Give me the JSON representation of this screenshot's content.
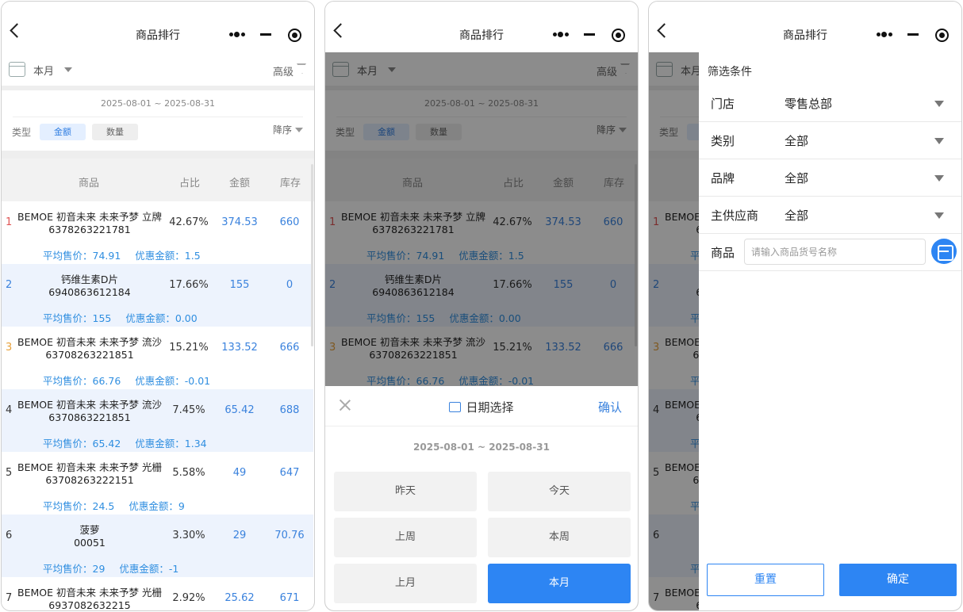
{
  "nav": {
    "title": "商品排行"
  },
  "filter": {
    "period": "本月",
    "advanced": "高级"
  },
  "range": "2025-08-01 ~ 2025-08-31",
  "type": {
    "label": "类型",
    "options": [
      "金额",
      "数量"
    ],
    "selected": "金额",
    "sort": "降序"
  },
  "table": {
    "headers": {
      "product": "商品",
      "ratio": "占比",
      "amount": "金额",
      "stock": "库存"
    },
    "rows": [
      {
        "rank": "1",
        "name": "BEMOE 初音未来 未来予梦 立牌",
        "code": "6378263221781",
        "ratio": "42.67%",
        "amount": "374.53",
        "stock": "660",
        "avg": "平均售价：74.91",
        "discount": "优惠金额：1.5",
        "rank_color": "#e05555"
      },
      {
        "rank": "2",
        "name": "钙维生素D片",
        "code": "6940863612184",
        "ratio": "17.66%",
        "amount": "155",
        "stock": "0",
        "avg": "平均售价：155",
        "discount": "优惠金额：0.00",
        "rank_color": "#3a82dd"
      },
      {
        "rank": "3",
        "name": "BEMOE 初音未来 未来予梦 流沙",
        "code": "63708263221851",
        "ratio": "15.21%",
        "amount": "133.52",
        "stock": "666",
        "avg": "平均售价：66.76",
        "discount": "优惠金额：-0.01",
        "rank_color": "#e8a23c"
      },
      {
        "rank": "4",
        "name": "BEMOE 初音未来 未来予梦 流沙",
        "code": "6370863221851",
        "ratio": "7.45%",
        "amount": "65.42",
        "stock": "688",
        "avg": "平均售价：65.42",
        "discount": "优惠金额：1.34",
        "rank_color": "#333333"
      },
      {
        "rank": "5",
        "name": "BEMOE 初音未来 未来予梦 光栅",
        "code": "63708263222151",
        "ratio": "5.58%",
        "amount": "49",
        "stock": "647",
        "avg": "平均售价：24.5",
        "discount": "优惠金额：9",
        "rank_color": "#333333"
      },
      {
        "rank": "6",
        "name": "菠萝",
        "code": "00051",
        "ratio": "3.30%",
        "amount": "29",
        "stock": "70.76",
        "avg": "平均售价：29",
        "discount": "优惠金额：-1",
        "rank_color": "#333333"
      },
      {
        "rank": "7",
        "name": "BEMOE 初音未来 未来予梦 光栅",
        "code": "6937082632215",
        "ratio": "2.92%",
        "amount": "25.62",
        "stock": "671",
        "avg": "",
        "discount": "",
        "rank_color": "#333333"
      }
    ]
  },
  "date_sheet": {
    "title": "日期选择",
    "confirm": "确认",
    "range": "2025-08-01 ~ 2025-08-31",
    "options": [
      "昨天",
      "今天",
      "上周",
      "本周",
      "上月",
      "本月"
    ],
    "selected": "本月"
  },
  "filter_panel": {
    "title": "筛选条件",
    "fields": [
      {
        "label": "门店",
        "value": "零售总部"
      },
      {
        "label": "类别",
        "value": "全部"
      },
      {
        "label": "品牌",
        "value": "全部"
      },
      {
        "label": "主供应商",
        "value": "全部"
      }
    ],
    "product_label": "商品",
    "product_placeholder": "请输入商品货号名称",
    "reset": "重置",
    "ok": "确定"
  },
  "colors": {
    "accent": "#2d85f3",
    "row_alt": "#edf3fd",
    "link": "#3a82dd"
  }
}
